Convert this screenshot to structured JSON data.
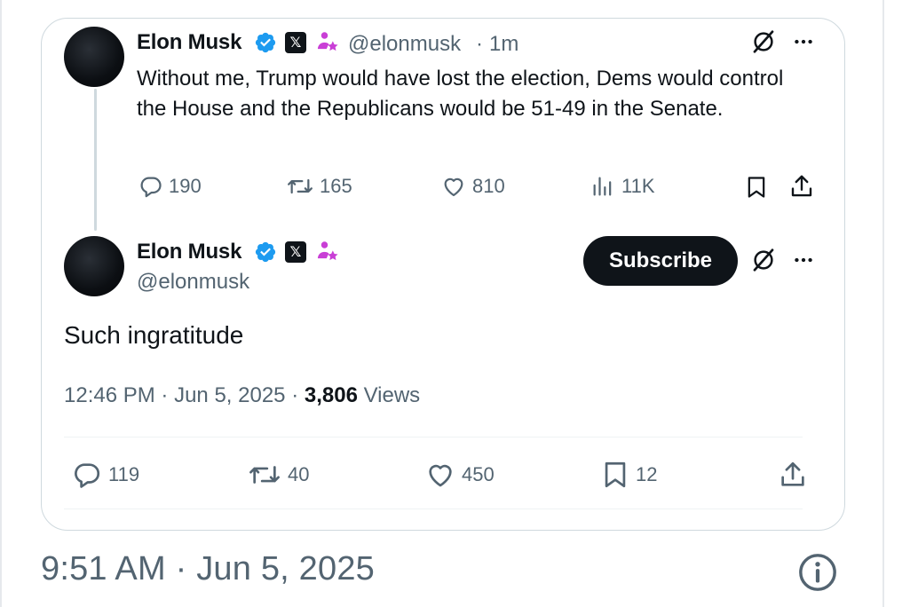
{
  "quoted_tweet": {
    "author_name": "Elon Musk",
    "handle": "@elonmusk",
    "time_sep": "·",
    "time_ago": "1m",
    "text": "Without me, Trump would have lost the election, Dems would control the House and the Republicans would be 51-49 in the Senate.",
    "replies": "190",
    "reposts": "165",
    "likes": "810",
    "views": "11K"
  },
  "main_tweet": {
    "author_name": "Elon Musk",
    "handle": "@elonmusk",
    "subscribe_label": "Subscribe",
    "text": "Such ingratitude",
    "time": "12:46 PM",
    "sep1": "·",
    "date": "Jun 5, 2025",
    "sep2": "·",
    "views_count": "3,806",
    "views_label": "Views",
    "replies": "119",
    "reposts": "40",
    "likes": "450",
    "bookmarks": "12"
  },
  "footer": {
    "timestamp": "9:51 AM · Jun 5, 2025"
  },
  "icons": {
    "verified": "verified-badge-icon",
    "x_badge": "x-logo-icon",
    "affiliate": "affiliate-people-icon",
    "grok": "grok-icon",
    "more": "more-dots-icon",
    "reply": "reply-icon",
    "repost": "repost-icon",
    "like": "heart-icon",
    "views": "views-chart-icon",
    "bookmark": "bookmark-icon",
    "share": "share-icon",
    "info": "info-icon"
  },
  "colors": {
    "verified_blue": "#1d9bf0",
    "affiliate_pink": "#c93fd6",
    "text_primary": "#0f1419",
    "text_secondary": "#536471",
    "border": "#cfd9de"
  }
}
